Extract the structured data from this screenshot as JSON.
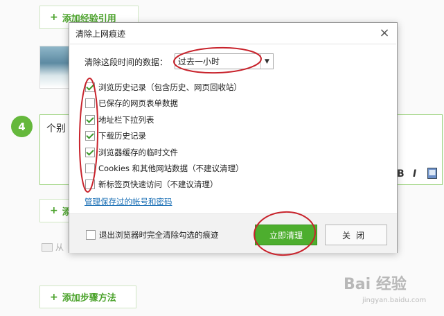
{
  "page": {
    "add_ref_label": "添加经验引用",
    "add_tool_label": "添",
    "add_step_label": "添加步骤方法",
    "plus": "+",
    "step_number": "4",
    "editor_text": "个别",
    "format_bold": "B",
    "format_italic": "I",
    "image_hint": "从",
    "watermark": "Bai 经验",
    "watermark_sub": "jingyan.baidu.com"
  },
  "dialog": {
    "title": "清除上网痕迹",
    "close_glyph": "×",
    "range_label": "清除这段时间的数据：",
    "range_value": "过去一小时",
    "options": [
      {
        "label": "浏览历史记录（包含历史、网页回收站）",
        "checked": true
      },
      {
        "label": "已保存的网页表单数据",
        "checked": false
      },
      {
        "label": "地址栏下拉列表",
        "checked": true
      },
      {
        "label": "下载历史记录",
        "checked": true
      },
      {
        "label": "浏览器缓存的临时文件",
        "checked": true
      },
      {
        "label": "Cookies 和其他网站数据（不建议清理）",
        "checked": false
      },
      {
        "label": "新标签页快速访问（不建议清理）",
        "checked": false
      }
    ],
    "manage_link": "管理保存过的帐号和密码",
    "exit_option_label": "退出浏览器时完全清除勾选的痕迹",
    "exit_option_checked": false,
    "clean_button": "立即清理",
    "close_button": "关闭"
  },
  "colors": {
    "accent": "#4dae2e",
    "link": "#1a6fb5",
    "annotation": "#c8232c"
  }
}
